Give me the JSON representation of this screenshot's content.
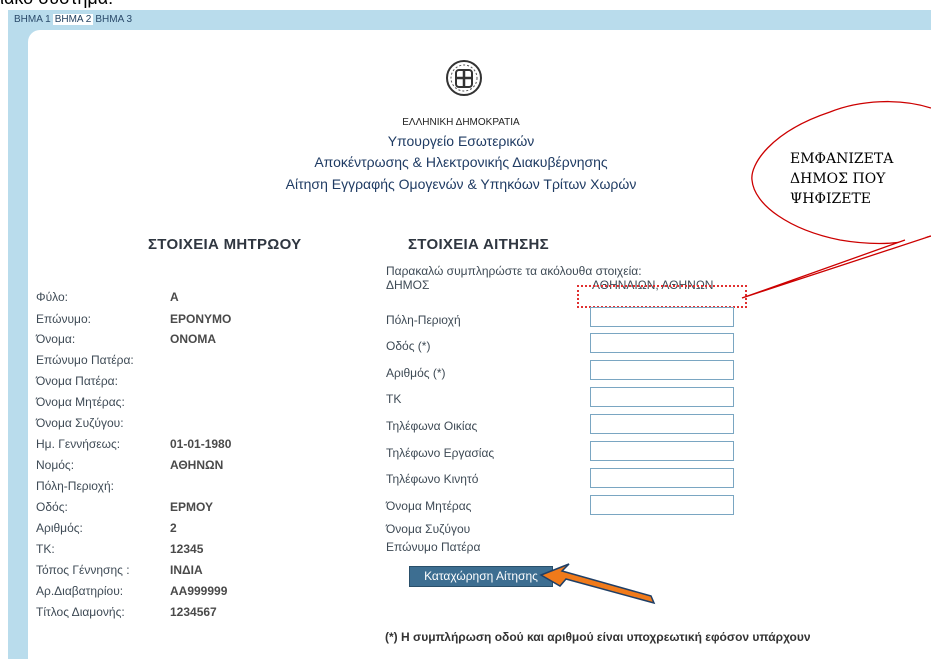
{
  "top_cut_text": "ιακό σύστημα:",
  "steps": [
    "ΒΗΜΑ 1",
    "ΒΗΜΑ 2",
    "ΒΗΜΑ 3"
  ],
  "header": {
    "republic": "ΕΛΛΗΝΙΚΗ ΔΗΜΟΚΡΑΤΙΑ",
    "ministry": "Υπουργείο Εσωτερικών",
    "ministry2": "Αποκέντρωσης & Ηλεκτρονικής Διακυβέρνησης",
    "subtitle": "Αίτηση Εγγραφής Ομογενών & Υπηκόων Τρίτων Χωρών"
  },
  "registry": {
    "title": "ΣΤΟΙΧΕΙΑ ΜΗΤΡΩΟΥ",
    "rows": [
      {
        "label": "Φύλο:",
        "value": "Α"
      },
      {
        "label": "Επώνυμο:",
        "value": "ΕΡΟΝΥΜΟ"
      },
      {
        "label": "Όνομα:",
        "value": "ΟΝΟΜΑ"
      },
      {
        "label": "Επώνυμο Πατέρα:",
        "value": ""
      },
      {
        "label": "Όνομα Πατέρα:",
        "value": ""
      },
      {
        "label": "Όνομα Μητέρας:",
        "value": ""
      },
      {
        "label": "Όνομα Συζύγου:",
        "value": ""
      },
      {
        "label": "Ημ. Γεννήσεως:",
        "value": "01-01-1980"
      },
      {
        "label": "Νομός:",
        "value": "ΑΘΗΝΩΝ"
      },
      {
        "label": "Πόλη-Περιοχή:",
        "value": ""
      },
      {
        "label": "Οδός:",
        "value": "ΕΡΜΟΥ"
      },
      {
        "label": "Αριθμός:",
        "value": "2"
      },
      {
        "label": "ΤΚ:",
        "value": "12345"
      },
      {
        "label": "Τόπος Γέννησης :",
        "value": "ΙΝΔΙΑ"
      },
      {
        "label": "Αρ.Διαβατηρίου:",
        "value": "ΑΑ999999"
      },
      {
        "label": "Τίτλος Διαμονής:",
        "value": "1234567"
      }
    ]
  },
  "application": {
    "title": "ΣΤΟΙΧΕΙΑ ΑΙΤΗΣΗΣ",
    "instruction": "Παρακαλώ συμπληρώστε τα ακόλουθα στοιχεία:",
    "municipality_label": "ΔΗΜΟΣ",
    "municipality_value": "ΑΘΗΝΑΙΩΝ, ΑΘΗΝΩΝ",
    "fields": [
      {
        "label": "Πόλη-Περιοχή"
      },
      {
        "label": "Οδός (*)"
      },
      {
        "label": "Αριθμός (*)"
      },
      {
        "label": "ΤΚ"
      },
      {
        "label": "Τηλέφωνα Οικίας"
      },
      {
        "label": "Τηλέφωνο Εργασίας"
      },
      {
        "label": "Τηλέφωνο Κινητό"
      },
      {
        "label": "Όνομα Μητέρας"
      }
    ],
    "extra_labels": [
      "Όνομα Συζύγου",
      "Επώνυμο Πατέρα"
    ],
    "submit_label": "Καταχώρηση Αίτησης",
    "note": "(*) Η συμπλήρωση οδού και αριθμού είναι υποχρεωτική εφόσον υπάρχουν"
  },
  "callout": {
    "lines": [
      "ΕΜΦΑΝΙΖΕΤΑ",
      "ΔΗΜΟΣ ΠΟΥ",
      "ΨΗΦΙΖΕΤΕ"
    ],
    "color": "#cc0000"
  },
  "arrow_color": "#f07a1a"
}
